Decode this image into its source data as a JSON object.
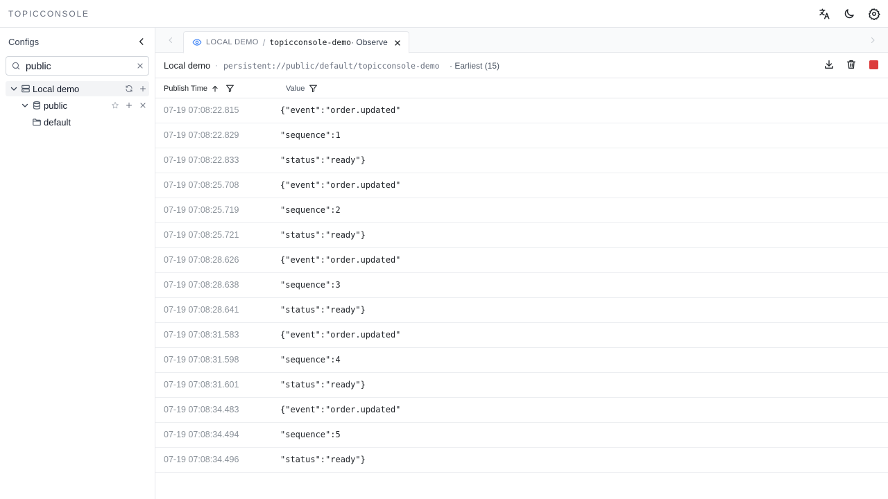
{
  "app": {
    "brand": "TOPICCONSOLE"
  },
  "top_actions": [
    "translate-icon",
    "moon-icon",
    "gear-icon"
  ],
  "sidebar": {
    "title": "Configs",
    "search": {
      "value": "public",
      "placeholder": ""
    },
    "tree": {
      "cluster": "Local demo",
      "tenant": "public",
      "namespace": "default"
    }
  },
  "tab": {
    "prefix": "LOCAL DEMO",
    "separator": "/",
    "topic": "topicconsole-demo",
    "mode": "· Observe"
  },
  "info": {
    "cluster": "Local demo",
    "dot": "·",
    "topic": "persistent://public/default/topicconsole-demo",
    "position": "· Earliest (15)"
  },
  "table": {
    "columns": [
      "Publish Time",
      "Value"
    ],
    "rows": [
      {
        "time": "07-19 07:08:22.815",
        "value": "{\"event\":\"order.updated\""
      },
      {
        "time": "07-19 07:08:22.829",
        "value": "\"sequence\":1"
      },
      {
        "time": "07-19 07:08:22.833",
        "value": "\"status\":\"ready\"}"
      },
      {
        "time": "07-19 07:08:25.708",
        "value": "{\"event\":\"order.updated\""
      },
      {
        "time": "07-19 07:08:25.719",
        "value": "\"sequence\":2"
      },
      {
        "time": "07-19 07:08:25.721",
        "value": "\"status\":\"ready\"}"
      },
      {
        "time": "07-19 07:08:28.626",
        "value": "{\"event\":\"order.updated\""
      },
      {
        "time": "07-19 07:08:28.638",
        "value": "\"sequence\":3"
      },
      {
        "time": "07-19 07:08:28.641",
        "value": "\"status\":\"ready\"}"
      },
      {
        "time": "07-19 07:08:31.583",
        "value": "{\"event\":\"order.updated\""
      },
      {
        "time": "07-19 07:08:31.598",
        "value": "\"sequence\":4"
      },
      {
        "time": "07-19 07:08:31.601",
        "value": "\"status\":\"ready\"}"
      },
      {
        "time": "07-19 07:08:34.483",
        "value": "{\"event\":\"order.updated\""
      },
      {
        "time": "07-19 07:08:34.494",
        "value": "\"sequence\":5"
      },
      {
        "time": "07-19 07:08:34.496",
        "value": "\"status\":\"ready\"}"
      }
    ]
  },
  "colors": {
    "accent": "#3b82f6",
    "stop": "#dc3b3b"
  }
}
